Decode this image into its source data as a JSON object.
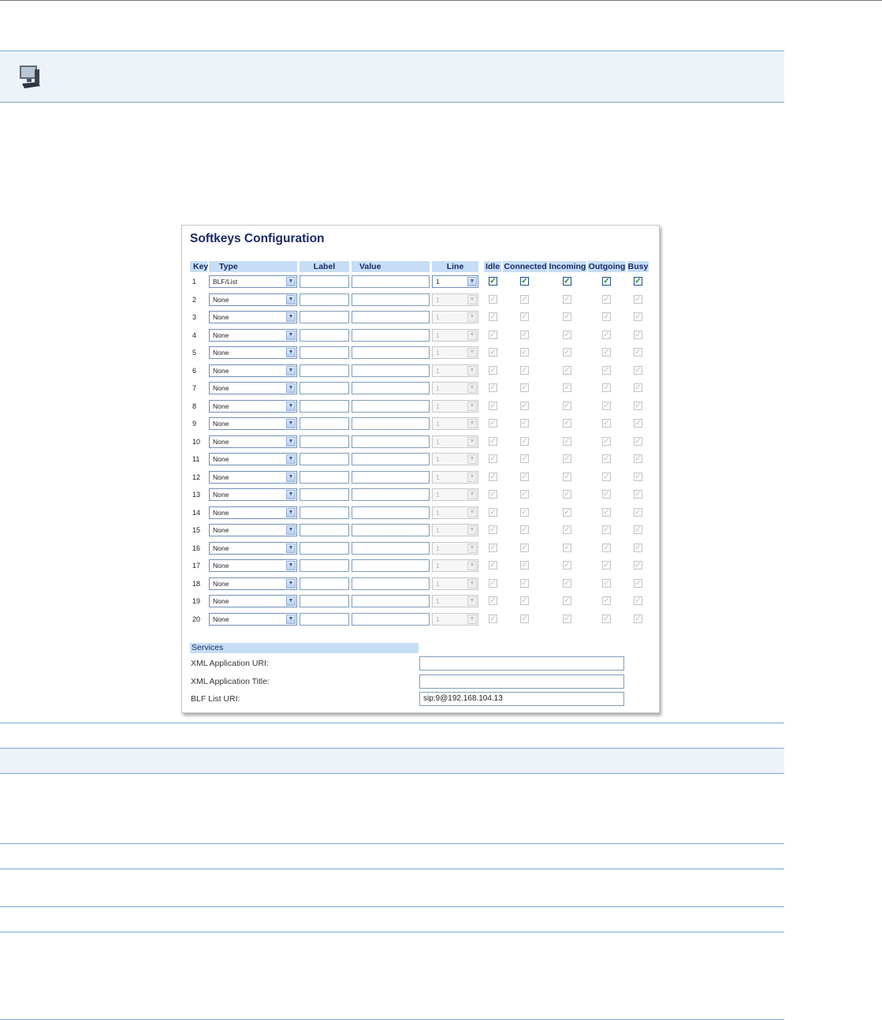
{
  "title": "Softkeys Configuration",
  "columns": {
    "key": "Key",
    "type": "Type",
    "label": "Label",
    "value": "Value",
    "line": "Line",
    "idle": "Idle",
    "connected": "Connected",
    "incoming": "Incoming",
    "outgoing": "Outgoing",
    "busy": "Busy"
  },
  "check_glyph": "✓",
  "arrow_glyph": "▼",
  "rows": [
    {
      "key": "1",
      "type": "BLF/List",
      "line": "1",
      "enabled": true
    },
    {
      "key": "2",
      "type": "None",
      "line": "1",
      "enabled": false
    },
    {
      "key": "3",
      "type": "None",
      "line": "1",
      "enabled": false
    },
    {
      "key": "4",
      "type": "None",
      "line": "1",
      "enabled": false
    },
    {
      "key": "5",
      "type": "None",
      "line": "1",
      "enabled": false
    },
    {
      "key": "6",
      "type": "None",
      "line": "1",
      "enabled": false
    },
    {
      "key": "7",
      "type": "None",
      "line": "1",
      "enabled": false
    },
    {
      "key": "8",
      "type": "None",
      "line": "1",
      "enabled": false
    },
    {
      "key": "9",
      "type": "None",
      "line": "1",
      "enabled": false
    },
    {
      "key": "10",
      "type": "None",
      "line": "1",
      "enabled": false
    },
    {
      "key": "11",
      "type": "None",
      "line": "1",
      "enabled": false
    },
    {
      "key": "12",
      "type": "None",
      "line": "1",
      "enabled": false
    },
    {
      "key": "13",
      "type": "None",
      "line": "1",
      "enabled": false
    },
    {
      "key": "14",
      "type": "None",
      "line": "1",
      "enabled": false
    },
    {
      "key": "15",
      "type": "None",
      "line": "1",
      "enabled": false
    },
    {
      "key": "16",
      "type": "None",
      "line": "1",
      "enabled": false
    },
    {
      "key": "17",
      "type": "None",
      "line": "1",
      "enabled": false
    },
    {
      "key": "18",
      "type": "None",
      "line": "1",
      "enabled": false
    },
    {
      "key": "19",
      "type": "None",
      "line": "1",
      "enabled": false
    },
    {
      "key": "20",
      "type": "None",
      "line": "1",
      "enabled": false
    }
  ],
  "services": {
    "header": "Services",
    "xml_uri_label": "XML Application URI:",
    "xml_uri_value": "",
    "xml_title_label": "XML Application Title:",
    "xml_title_value": "",
    "blf_uri_label": "BLF List URI:",
    "blf_uri_value": "sip:9@192.168.104.13"
  },
  "icons": {
    "computer": "computer-icon"
  },
  "colors": {
    "header_bg": "#c6ddf5",
    "title": "#1a2a6a",
    "rule": "#7aa6d6",
    "band": "#eef3f9"
  }
}
